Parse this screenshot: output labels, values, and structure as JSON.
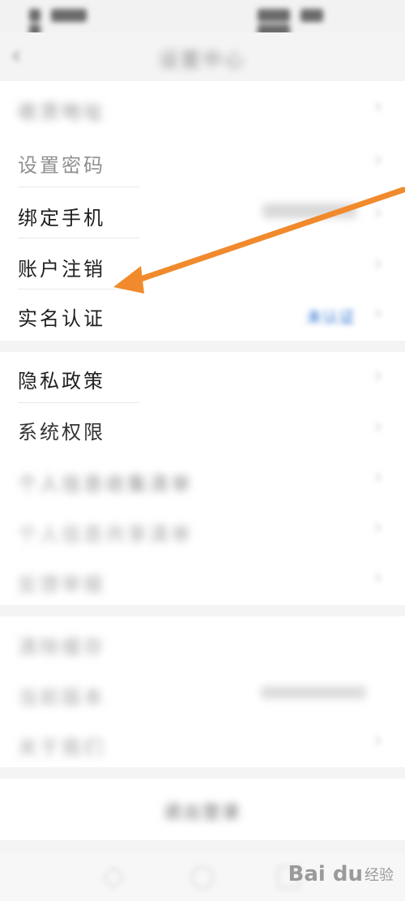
{
  "status_bar": {
    "left_text": "",
    "right_text": ""
  },
  "header": {
    "back_glyph": "‹",
    "title": "设置中心"
  },
  "group1": {
    "items": [
      {
        "label": "收货地址",
        "value": ""
      },
      {
        "label": "设置密码",
        "value": ""
      },
      {
        "label": "绑定手机",
        "value": ""
      },
      {
        "label": "账户注销",
        "value": ""
      },
      {
        "label": "实名认证",
        "value": "未认证"
      }
    ]
  },
  "group2": {
    "items": [
      {
        "label": "隐私政策"
      },
      {
        "label": "系统权限"
      },
      {
        "label": "个人信息收集清单"
      },
      {
        "label": "个人信息共享清单"
      },
      {
        "label": "反馈举报"
      }
    ]
  },
  "group3": {
    "items": [
      {
        "label": "清除缓存",
        "value": ""
      },
      {
        "label": "当前版本",
        "value": ""
      },
      {
        "label": "关于我们",
        "value": ""
      }
    ]
  },
  "logout": {
    "label": "退出登录"
  },
  "chevron_glyph": "›",
  "annotation": {
    "color": "#f08a2c"
  },
  "watermark": {
    "logo": "Bai du",
    "sub": "经验"
  }
}
